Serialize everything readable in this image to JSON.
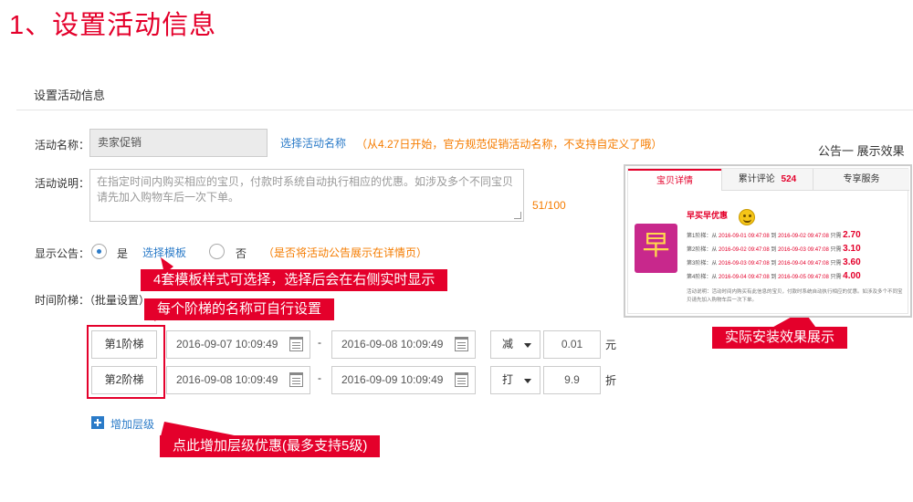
{
  "big_title": "1、设置活动信息",
  "section_title": "设置活动信息",
  "activity_name": {
    "label": "活动名称：",
    "value": "卖家促销",
    "link": "选择活动名称",
    "hint": "（从4.27日开始，官方规范促销活动名称，不支持自定义了哦）"
  },
  "activity_desc": {
    "label": "活动说明：",
    "placeholder": "在指定时间内购买相应的宝贝，付款时系统自动执行相应的优惠。如涉及多个不同宝贝请先加入购物车后一次下单。",
    "counter": "51/100"
  },
  "announcement": {
    "label": "显示公告：",
    "yes": "是",
    "template_link": "选择模板",
    "no": "否",
    "hint": "（是否将活动公告展示在详情页）"
  },
  "stages": {
    "label": "时间阶梯：（批量设置）",
    "rows": [
      {
        "name": "第1阶梯",
        "start": "2016-09-07 10:09:49",
        "end": "2016-09-08 10:09:49",
        "type": "减",
        "value": "0.01",
        "unit": "元"
      },
      {
        "name": "第2阶梯",
        "start": "2016-09-08 10:09:49",
        "end": "2016-09-09 10:09:49",
        "type": "打",
        "value": "9.9",
        "unit": "折"
      }
    ],
    "dash": "-",
    "add_label": "增加层级"
  },
  "callouts": {
    "templates": "4套模板样式可选择，选择后会在右侧实时显示",
    "stage_names": "每个阶梯的名称可自行设置",
    "add_level": "点此增加层级优惠(最多支持5级)",
    "preview": "实际安装效果展示"
  },
  "preview": {
    "caption": "公告一 展示效果",
    "tabs": [
      "宝贝详情",
      "累计评论",
      "专享服务"
    ],
    "review_count": "524",
    "logo_char": "早",
    "title": "早买早优惠",
    "rows": [
      {
        "stage": "第1阶梯：从",
        "from": "2016-09-01 09:47:08",
        "to_word": "到",
        "to": "2016-09-02 09:47:08",
        "only": "只需",
        "price": "2.70"
      },
      {
        "stage": "第2阶梯：从",
        "from": "2016-09-02 09:47:08",
        "to_word": "到",
        "to": "2016-09-03 09:47:08",
        "only": "只需",
        "price": "3.10"
      },
      {
        "stage": "第3阶梯：从",
        "from": "2016-09-03 09:47:08",
        "to_word": "到",
        "to": "2016-09-04 09:47:08",
        "only": "只需",
        "price": "3.60"
      },
      {
        "stage": "第4阶梯：从",
        "from": "2016-09-04 09:47:08",
        "to_word": "到",
        "to": "2016-09-05 09:47:08",
        "only": "只需",
        "price": "4.00"
      }
    ],
    "note": "活动说明：活动时间内购买有此信息的宝贝，付款时系统自动执行相应的优惠。如涉及多个不同宝贝请先加入购物车后一次下单。"
  },
  "colors": {
    "accent_red": "#e4002b",
    "link_blue": "#2b7bc8",
    "hint_orange": "#f57c00"
  }
}
